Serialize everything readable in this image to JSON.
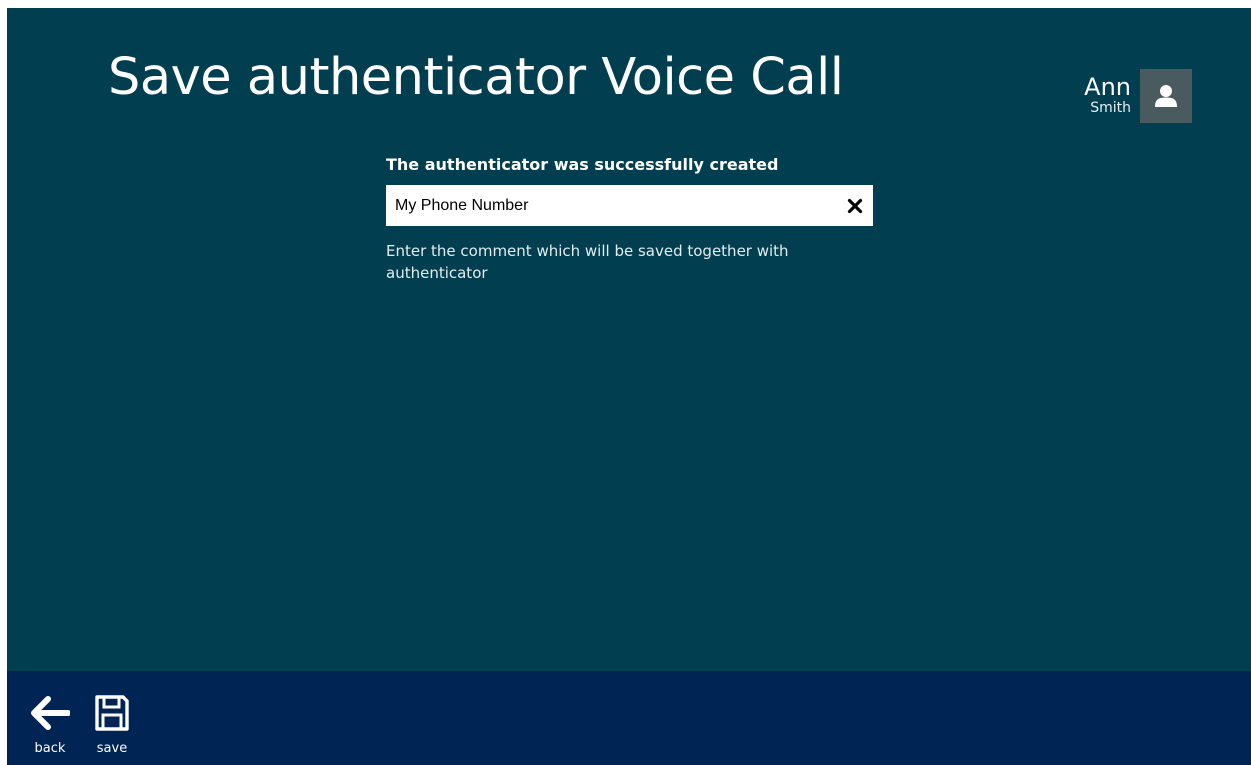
{
  "page": {
    "title": "Save authenticator Voice Call"
  },
  "user": {
    "first_name": "Ann",
    "last_name": "Smith",
    "avatar_icon": "user-icon"
  },
  "form": {
    "heading": "The authenticator was successfully created",
    "comment_value": "My Phone Number",
    "clear_icon": "close-icon",
    "hint": "Enter the comment which will be saved together with authenticator"
  },
  "appbar": {
    "back_label": "back",
    "back_icon": "arrow-left-icon",
    "save_label": "save",
    "save_icon": "floppy-disk-icon"
  },
  "colors": {
    "background": "#013f50",
    "appbar": "#002453",
    "avatar": "#4a5b5f",
    "text": "#ffffff"
  }
}
